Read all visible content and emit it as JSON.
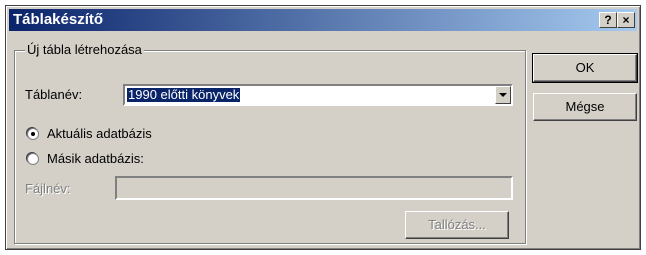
{
  "dialog": {
    "title": "Táblakészítő",
    "help_button": "?",
    "close_button": "×"
  },
  "group": {
    "legend": "Új tábla létrehozása",
    "table_name_label": "Táblanév:",
    "table_name_value": "1990 előtti könyvek",
    "radio_current_label": "Aktuális adatbázis",
    "radio_other_label": "Másik adatbázis:",
    "file_name_label": "Fájlnév:",
    "file_name_value": "",
    "browse_label": "Tallózás..."
  },
  "buttons": {
    "ok": "OK",
    "cancel": "Mégse"
  },
  "state": {
    "selected_database": "Aktuális adatbázis"
  }
}
